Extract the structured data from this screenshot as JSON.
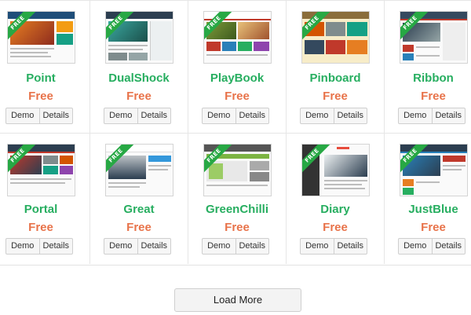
{
  "themes": [
    {
      "name": "Point",
      "price": "Free",
      "badge": "FREE",
      "demo": "Demo",
      "details": "Details",
      "accent": "#1f4e79",
      "accent2": "#e67e22"
    },
    {
      "name": "DualShock",
      "price": "Free",
      "badge": "FREE",
      "demo": "Demo",
      "details": "Details",
      "accent": "#2c3e50",
      "accent2": "#3aa8a0"
    },
    {
      "name": "PlayBook",
      "price": "Free",
      "badge": "FREE",
      "demo": "Demo",
      "details": "Details",
      "accent": "#c0392b",
      "accent2": "#7e9b3a"
    },
    {
      "name": "Pinboard",
      "price": "Free",
      "badge": "FREE",
      "demo": "Demo",
      "details": "Details",
      "accent": "#f2e6c0",
      "accent2": "#8a6d3b"
    },
    {
      "name": "Ribbon",
      "price": "Free",
      "badge": "FREE",
      "demo": "Demo",
      "details": "Details",
      "accent": "#c0392b",
      "accent2": "#34495e"
    },
    {
      "name": "Portal",
      "price": "Free",
      "badge": "FREE",
      "demo": "Demo",
      "details": "Details",
      "accent": "#2c3e50",
      "accent2": "#c0392b"
    },
    {
      "name": "Great",
      "price": "Free",
      "badge": "FREE",
      "demo": "Demo",
      "details": "Details",
      "accent": "#bdc3c7",
      "accent2": "#3498db"
    },
    {
      "name": "GreenChilli",
      "price": "Free",
      "badge": "FREE",
      "demo": "Demo",
      "details": "Details",
      "accent": "#7cb342",
      "accent2": "#555555"
    },
    {
      "name": "Diary",
      "price": "Free",
      "badge": "FREE",
      "demo": "Demo",
      "details": "Details",
      "accent": "#333333",
      "accent2": "#e74c3c"
    },
    {
      "name": "JustBlue",
      "price": "Free",
      "badge": "FREE",
      "demo": "Demo",
      "details": "Details",
      "accent": "#2c3e50",
      "accent2": "#2980b9"
    }
  ],
  "load_more_label": "Load More",
  "colors": {
    "name_green": "#27ae60",
    "price_orange": "#e8734a",
    "ribbon_green": "#27a844"
  }
}
